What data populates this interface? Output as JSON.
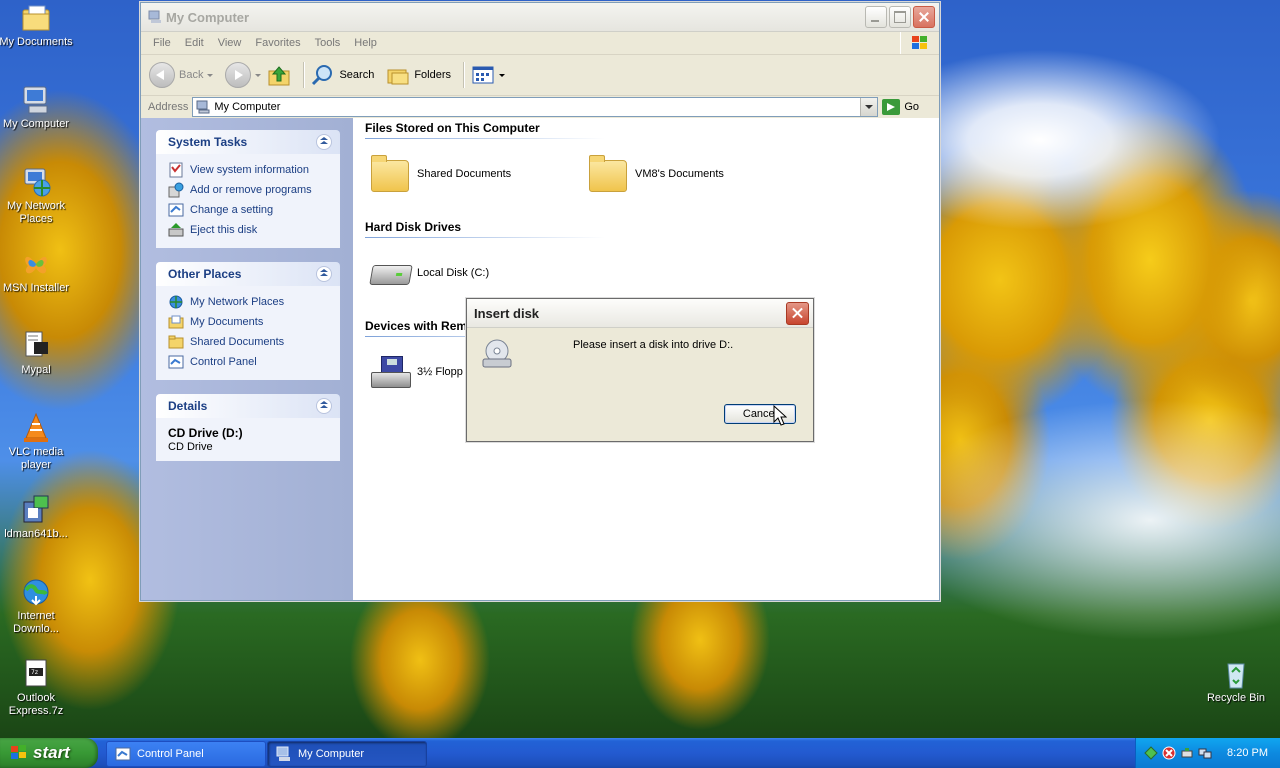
{
  "desktop": {
    "icons": [
      {
        "label": "My Documents"
      },
      {
        "label": "My Computer"
      },
      {
        "label": "My Network Places"
      },
      {
        "label": "MSN Installer"
      },
      {
        "label": "Mypal"
      },
      {
        "label": "VLC media player"
      },
      {
        "label": "ldman641b..."
      },
      {
        "label": "Internet Downlo..."
      },
      {
        "label": "Outlook Express.7z"
      },
      {
        "label": "Recycle Bin"
      }
    ]
  },
  "window": {
    "title": "My Computer",
    "menu": [
      "File",
      "Edit",
      "View",
      "Favorites",
      "Tools",
      "Help"
    ],
    "toolbar": {
      "back": "Back",
      "search": "Search",
      "folders": "Folders"
    },
    "address": {
      "label": "Address",
      "value": "My Computer",
      "go": "Go"
    },
    "taskpane": {
      "system_tasks": {
        "title": "System Tasks",
        "items": [
          "View system information",
          "Add or remove programs",
          "Change a setting",
          "Eject this disk"
        ]
      },
      "other_places": {
        "title": "Other Places",
        "items": [
          "My Network Places",
          "My Documents",
          "Shared Documents",
          "Control Panel"
        ]
      },
      "details": {
        "title": "Details",
        "name": "CD Drive (D:)",
        "type": "CD Drive"
      }
    },
    "content": {
      "groups": [
        {
          "title": "Files Stored on This Computer",
          "items": [
            "Shared Documents",
            "VM8's Documents"
          ]
        },
        {
          "title": "Hard Disk Drives",
          "items": [
            "Local Disk (C:)"
          ]
        },
        {
          "title": "Devices with Rem",
          "items": [
            "3½ Flopp"
          ]
        }
      ]
    }
  },
  "dialog": {
    "title": "Insert disk",
    "message": "Please insert a disk into drive D:.",
    "button": "Cancel"
  },
  "taskbar": {
    "start": "start",
    "tasks": [
      "Control Panel",
      "My Computer"
    ],
    "clock": "8:20 PM"
  },
  "colors": {
    "taskbar_blue": "#235ad0",
    "start_green": "#389935",
    "link_blue": "#1c3f84"
  }
}
